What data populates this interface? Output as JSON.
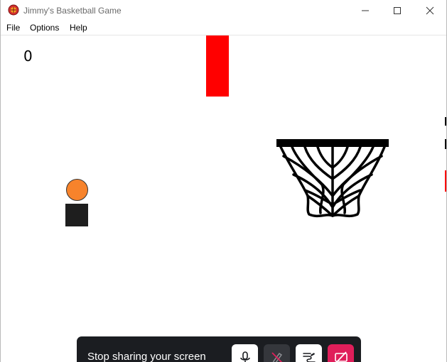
{
  "window": {
    "title": "Jimmy's Basketball Game",
    "icon": "basketball-app-icon",
    "controls": [
      "minimize-icon",
      "maximize-icon",
      "close-icon"
    ]
  },
  "menu": {
    "items": [
      {
        "label": "File"
      },
      {
        "label": "Options"
      },
      {
        "label": "Help"
      }
    ]
  },
  "game": {
    "score": "0",
    "colors": {
      "paddle": "#ff0000",
      "ball": "#f7832b",
      "player": "#1e1e1e",
      "hoop": "#000000"
    }
  },
  "share_bar": {
    "label": "Stop sharing your screen",
    "buttons": [
      {
        "icon": "microphone-icon"
      },
      {
        "icon": "pen-off-icon"
      },
      {
        "icon": "draw-scribble-icon"
      },
      {
        "icon": "stop-share-icon"
      }
    ],
    "colors": {
      "background": "#1b1d21",
      "stop": "#e01e5a"
    }
  }
}
